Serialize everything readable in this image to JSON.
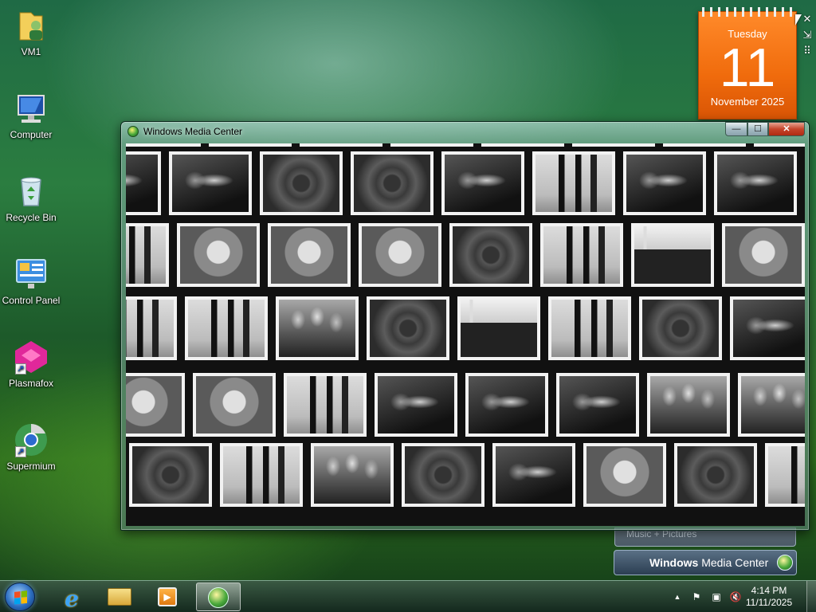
{
  "desktop": {
    "icons": [
      {
        "label": "VM1",
        "icon": "user-folder-icon"
      },
      {
        "label": "Computer",
        "icon": "computer-icon"
      },
      {
        "label": "Recycle Bin",
        "icon": "recycle-bin-icon"
      },
      {
        "label": "Control Panel",
        "icon": "control-panel-icon"
      },
      {
        "label": "Plasmafox",
        "icon": "plasmafox-icon"
      },
      {
        "label": "Supermium",
        "icon": "supermium-icon"
      }
    ]
  },
  "calendar_gadget": {
    "weekday": "Tuesday",
    "day": "11",
    "month_year": "November 2025",
    "close_glyph": "✕",
    "resize_glyph": "⇲",
    "drag_glyph": "⠿"
  },
  "window": {
    "title": "Windows Media Center",
    "minimize_glyph": "—",
    "maximize_glyph": "☐",
    "close_glyph": "✕",
    "slideshow_rows": [
      [
        "flower",
        "penguins",
        "flower",
        "jelly",
        "koala",
        "penguins",
        "flower",
        "koala"
      ],
      [
        "jelly",
        "jelly",
        "flower",
        "flower",
        "jelly",
        "penguins",
        "jelly",
        "jelly"
      ],
      [
        "penguins",
        "koala",
        "koala",
        "koala",
        "flower",
        "penguins",
        "lighthouse",
        "koala",
        "koala"
      ],
      [
        "penguins",
        "penguins",
        "tulips",
        "flower",
        "lighthouse",
        "penguins",
        "flower",
        "jelly"
      ],
      [
        "koala",
        "koala",
        "penguins",
        "jelly",
        "jelly",
        "jelly",
        "tulips",
        "tulips",
        "koala"
      ],
      [
        "flower",
        "penguins",
        "tulips",
        "flower",
        "jelly",
        "koala",
        "flower",
        "penguins"
      ]
    ]
  },
  "taskbar_preview": {
    "label": "Music + Pictures",
    "title_prefix": "Windows",
    "title_suffix": " Media Center"
  },
  "taskbar": {
    "pinned": [
      {
        "name": "internet-explorer",
        "icon": "ie-icon",
        "glyph": "e"
      },
      {
        "name": "windows-explorer",
        "icon": "folder-icon",
        "glyph": ""
      },
      {
        "name": "media-player",
        "icon": "media-player-icon",
        "glyph": "▶"
      },
      {
        "name": "windows-media-center",
        "icon": "wmc-icon",
        "glyph": ""
      }
    ],
    "tray": {
      "expand_glyph": "▲",
      "flag_glyph": "⚑",
      "network_glyph": "▣",
      "volume_glyph": "🔇"
    },
    "clock": {
      "time": "4:14 PM",
      "date": "11/11/2025"
    }
  },
  "colors": {
    "calendar_accent": "#f06b0c",
    "close_button": "#c5442a"
  }
}
